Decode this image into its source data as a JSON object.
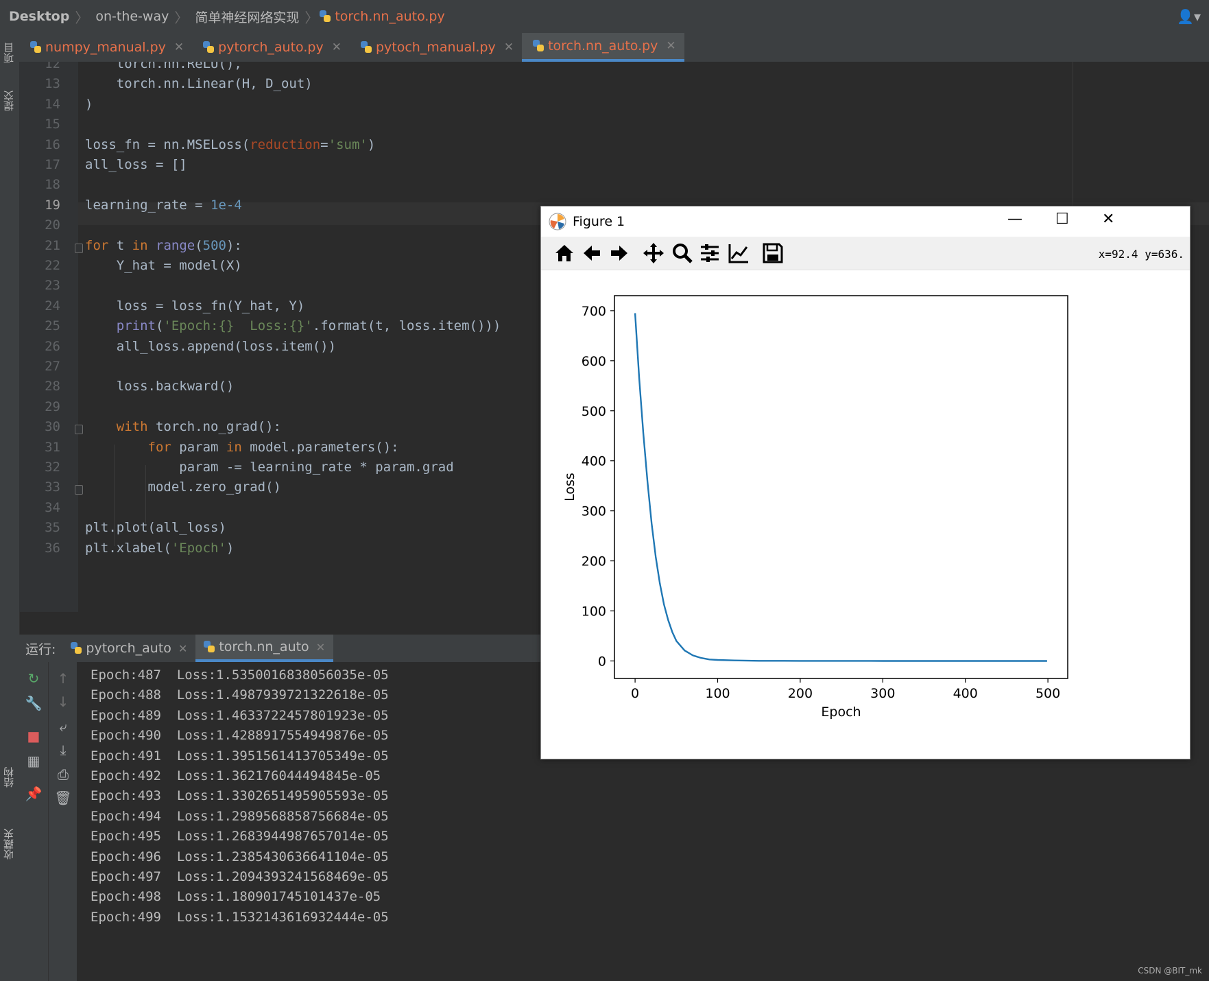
{
  "breadcrumb": [
    "Desktop",
    "on-the-way",
    "简单神经网络实现",
    "torch.nn_auto.py"
  ],
  "left_strip": {
    "project": "项目",
    "commit": "提交",
    "structure": "结构",
    "favorites": "收藏夹"
  },
  "editor_tabs": [
    {
      "label": "numpy_manual.py",
      "active": false
    },
    {
      "label": "pytorch_auto.py",
      "active": false
    },
    {
      "label": "pytoch_manual.py",
      "active": false
    },
    {
      "label": "torch.nn_auto.py",
      "active": true
    }
  ],
  "line_numbers": [
    "12",
    "13",
    "14",
    "15",
    "16",
    "17",
    "18",
    "19",
    "20",
    "21",
    "22",
    "23",
    "24",
    "25",
    "26",
    "27",
    "28",
    "29",
    "30",
    "31",
    "32",
    "33",
    "34",
    "35",
    "36"
  ],
  "current_line": "19",
  "code_lines": [
    "    torch.nn.ReLU(),",
    "    torch.nn.Linear(H, D_out)",
    ")",
    "",
    "loss_fn = nn.MSELoss(reduction='sum')",
    "all_loss = []",
    "",
    "learning_rate = 1e-4",
    "",
    "for t in range(500):",
    "    Y_hat = model(X)",
    "",
    "    loss = loss_fn(Y_hat, Y)",
    "    print('Epoch:{}  Loss:{}'.format(t, loss.item()))",
    "    all_loss.append(loss.item())",
    "",
    "    loss.backward()",
    "",
    "    with torch.no_grad():",
    "        for param in model.parameters():",
    "            param -= learning_rate * param.grad",
    "        model.zero_grad()",
    "",
    "plt.plot(all_loss)",
    "plt.xlabel('Epoch')"
  ],
  "run_panel": {
    "label": "运行:",
    "tabs": [
      {
        "label": "pytorch_auto",
        "active": false
      },
      {
        "label": "torch.nn_auto",
        "active": true
      }
    ]
  },
  "console_lines": [
    "Epoch:487  Loss:1.5350016838056035e-05",
    "Epoch:488  Loss:1.4987939721322618e-05",
    "Epoch:489  Loss:1.4633722457801923e-05",
    "Epoch:490  Loss:1.4288917554949876e-05",
    "Epoch:491  Loss:1.3951561413705349e-05",
    "Epoch:492  Loss:1.362176044494845e-05",
    "Epoch:493  Loss:1.3302651495905593e-05",
    "Epoch:494  Loss:1.2989568858756684e-05",
    "Epoch:495  Loss:1.2683944987657014e-05",
    "Epoch:496  Loss:1.2385430636641104e-05",
    "Epoch:497  Loss:1.2094393241568469e-05",
    "Epoch:498  Loss:1.180901745101437e-05",
    "Epoch:499  Loss:1.1532143616932444e-05"
  ],
  "figure": {
    "title": "Figure 1",
    "coords": "x=92.4  y=636.",
    "toolbar": [
      "home-icon",
      "back-icon",
      "forward-icon",
      "pan-icon",
      "zoom-icon",
      "configure-icon",
      "edit-axis-icon",
      "save-icon"
    ]
  },
  "chart_data": {
    "type": "line",
    "title": "",
    "xlabel": "Epoch",
    "ylabel": "Loss",
    "xlim": [
      -25,
      524
    ],
    "ylim": [
      -35,
      730
    ],
    "xticks": [
      0,
      100,
      200,
      300,
      400,
      500
    ],
    "yticks": [
      0,
      100,
      200,
      300,
      400,
      500,
      600,
      700
    ],
    "series": [
      {
        "color": "#1f77b4",
        "x": [
          0,
          5,
          10,
          15,
          20,
          25,
          30,
          35,
          40,
          45,
          50,
          60,
          70,
          80,
          90,
          100,
          120,
          150,
          200,
          300,
          400,
          499
        ],
        "y": [
          695,
          565,
          455,
          358,
          275,
          208,
          155,
          113,
          82,
          58,
          40,
          21,
          11,
          6,
          3,
          2,
          1,
          0.3,
          0.1,
          0.01,
          0.001,
          1e-05
        ]
      }
    ]
  },
  "watermark": "CSDN @BIT_mk"
}
